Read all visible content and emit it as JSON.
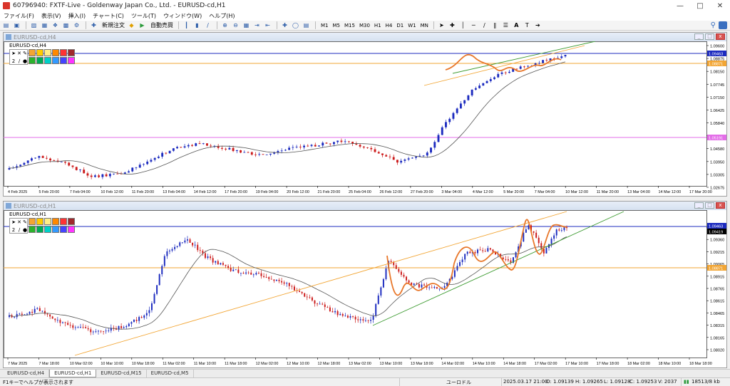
{
  "window": {
    "title": "60796940: FXTF-Live - Goldenway Japan Co., Ltd. - EURUSD-cd,H1"
  },
  "menu": [
    "ファイル(F)",
    "表示(V)",
    "挿入(I)",
    "チャート(C)",
    "ツール(T)",
    "ウィンドウ(W)",
    "ヘルプ(H)"
  ],
  "toolbar": {
    "new_order": "新規注文",
    "auto_trade": "自動売買",
    "timeframes": [
      "M1",
      "M5",
      "M15",
      "M30",
      "H1",
      "H4",
      "D1",
      "W1",
      "MN"
    ]
  },
  "charts": [
    {
      "id": "h4",
      "window_title": "EURUSD-cd,H4",
      "symbol_label": "EURUSD-cd,H4",
      "price_labels": [
        "1.09600",
        "1.08875",
        "1.08150",
        "1.07745",
        "1.07150",
        "1.06425",
        "1.05840",
        "1.05115",
        "1.04580",
        "1.03950",
        "1.03305",
        "1.02675"
      ],
      "marker_labels": [
        {
          "text": "1.09463",
          "color": "#1c2bbf"
        },
        {
          "text": "1.08871",
          "color": "#f2a533"
        },
        {
          "text": "1.05191",
          "color": "#e36de8"
        }
      ],
      "time_labels": [
        "4 Feb 2025",
        "5 Feb 20:00",
        "7 Feb 04:00",
        "10 Feb 12:00",
        "11 Feb 20:00",
        "13 Feb 04:00",
        "14 Feb 12:00",
        "17 Feb 20:00",
        "19 Feb 04:00",
        "20 Feb 12:00",
        "21 Feb 20:00",
        "25 Feb 04:00",
        "26 Feb 12:00",
        "27 Feb 20:00",
        "3 Mar 04:00",
        "4 Mar 12:00",
        "5 Mar 20:00",
        "7 Mar 04:00",
        "10 Mar 12:00",
        "11 Mar 20:00",
        "13 Mar 04:00",
        "14 Mar 12:00",
        "17 Mar 20:00"
      ]
    },
    {
      "id": "h1",
      "window_title": "EURUSD-cd,H1",
      "symbol_label": "EURUSD-cd,H1",
      "price_labels": [
        "1.09505",
        "1.09360",
        "1.09215",
        "1.09065",
        "1.08915",
        "1.08765",
        "1.08615",
        "1.08465",
        "1.08315",
        "1.08165",
        "1.08020"
      ],
      "marker_labels": [
        {
          "text": "1.09463",
          "color": "#1c2bbf"
        },
        {
          "text": "1.09419",
          "color": "#000000"
        },
        {
          "text": "1.08871",
          "color": "#f2a533"
        }
      ],
      "time_labels": [
        "7 Mar 2025",
        "7 Mar 18:00",
        "10 Mar 02:00",
        "10 Mar 10:00",
        "10 Mar 18:00",
        "11 Mar 02:00",
        "11 Mar 10:00",
        "11 Mar 18:00",
        "12 Mar 02:00",
        "12 Mar 10:00",
        "12 Mar 18:00",
        "13 Mar 02:00",
        "13 Mar 10:00",
        "13 Mar 18:00",
        "14 Mar 02:00",
        "14 Mar 10:00",
        "14 Mar 18:00",
        "17 Mar 02:00",
        "17 Mar 10:00",
        "17 Mar 18:00",
        "18 Mar 02:00",
        "18 Mar 10:00",
        "18 Mar 18:00"
      ]
    }
  ],
  "tabs": [
    "EURUSD-cd,H4",
    "EURUSD-cd,H1",
    "EURUSD-cd,M15",
    "EURUSD-cd,M5"
  ],
  "active_tab": "EURUSD-cd,H1",
  "status": {
    "help": "F1キーでヘルプが表示されます",
    "symbol": "ユーロドル",
    "datetime": "2025.03.17 21:00",
    "open": "O: 1.09139",
    "high": "H: 1.09265",
    "low": "L: 1.09128",
    "close": "C: 1.09253",
    "volume": "V: 2037",
    "traffic": "18513/8 kb"
  },
  "colors": {
    "bull": "#1c2bbf",
    "bear": "#cc1b1b",
    "ma": "#555555",
    "orange": "#f2a533",
    "fib": "#e8772a",
    "green": "#3b9a2f",
    "magenta": "#e36de8"
  }
}
